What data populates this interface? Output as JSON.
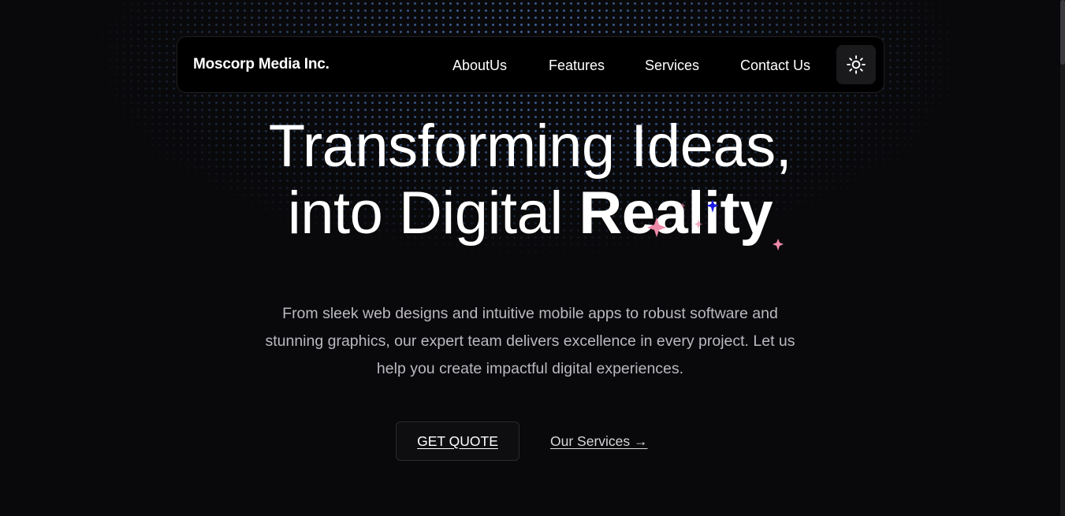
{
  "brand": {
    "name": "Moscorp Media Inc."
  },
  "nav": {
    "links": [
      "AboutUs",
      "Features",
      "Services",
      "Contact Us"
    ],
    "theme_toggle_icon": "sun-icon"
  },
  "hero": {
    "line1": "Transforming Ideas,",
    "line2_prefix": "into Digital ",
    "line2_bold": "Reality",
    "description": "From sleek web designs and intuitive mobile apps to robust software and stunning graphics, our expert team delivers excellence in every project. Let us help you create impactful digital experiences.",
    "primary_button": "GET QUOTE",
    "secondary_link": "Our Services →"
  },
  "colors": {
    "background": "#09090b",
    "navbar": "#000000",
    "dots": "#5a8cdc",
    "sparkle_pink": "#f08aaa",
    "sparkle_blue": "#1a1ae6",
    "muted_text": "#b9b9c0"
  }
}
